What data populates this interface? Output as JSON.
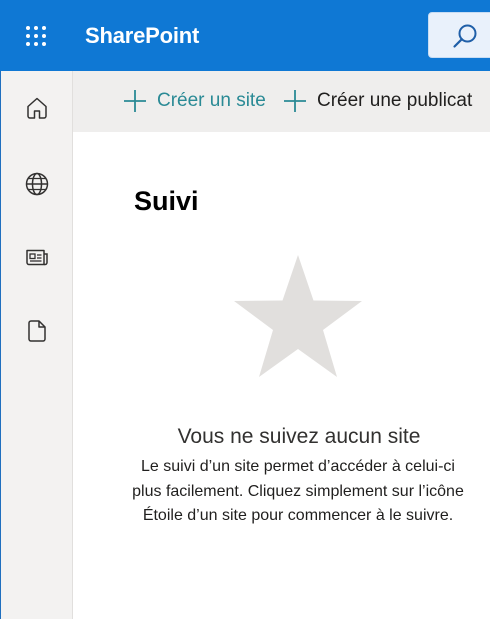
{
  "suite_bar": {
    "app_name": "SharePoint",
    "waffle_icon": "app-launcher-icon",
    "search_icon": "search-icon",
    "background_color": "#0f78d4"
  },
  "left_rail": {
    "items": [
      {
        "icon": "home-icon"
      },
      {
        "icon": "globe-icon"
      },
      {
        "icon": "news-icon"
      },
      {
        "icon": "document-icon"
      }
    ]
  },
  "command_bar": {
    "create_site_label": "Créer un site",
    "create_post_label": "Créer une publicat",
    "accent_color": "#2a8a95"
  },
  "main": {
    "title": "Suivi",
    "empty_state": {
      "icon": "star-icon",
      "heading": "Vous ne suivez aucun site",
      "body": "Le suivi d’un site permet d’accéder à celui-ci plus facilement. Cliquez simplement sur l’icône Étoile d’un site pour commencer à le suivre."
    }
  }
}
